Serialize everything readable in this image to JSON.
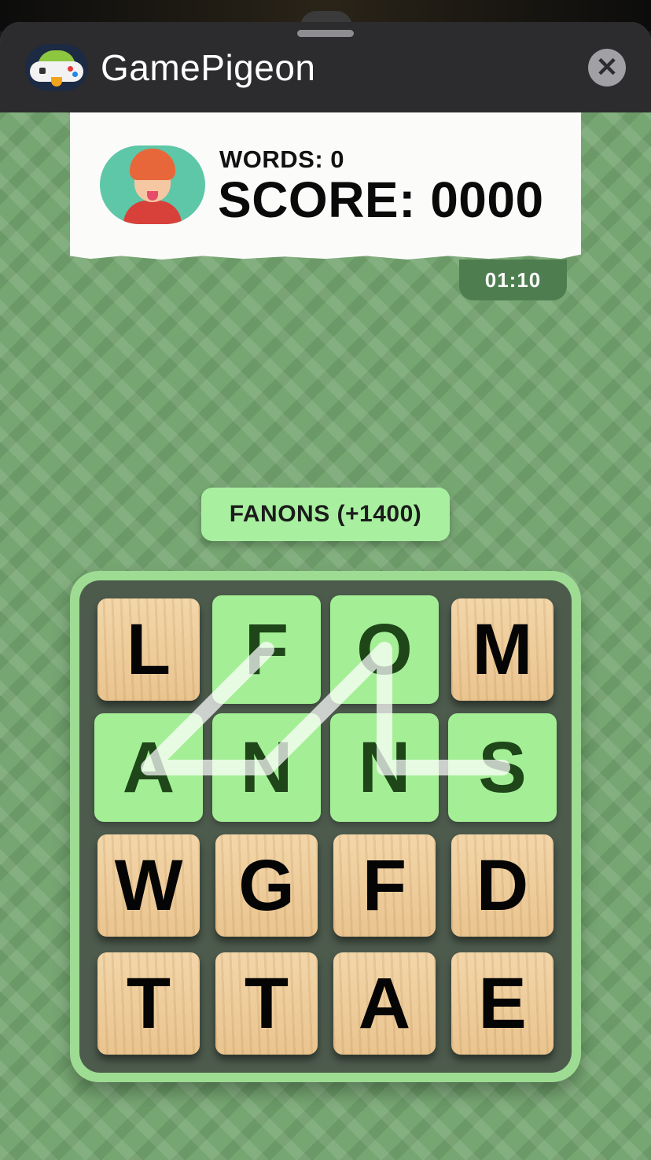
{
  "app": {
    "title": "GamePigeon",
    "close_glyph": "✕",
    "icon": "gamepigeon-bird-icon"
  },
  "player": {
    "avatar": "player-avatar",
    "words_text": "WORDS: 0",
    "score_text": "SCORE: 0000"
  },
  "timer": {
    "value": "01:10"
  },
  "current_word": {
    "text": "FANONS (+1400)"
  },
  "board": {
    "rows": [
      [
        "L",
        "F",
        "O",
        "M"
      ],
      [
        "A",
        "N",
        "N",
        "S"
      ],
      [
        "W",
        "G",
        "F",
        "D"
      ],
      [
        "T",
        "T",
        "A",
        "E"
      ]
    ],
    "selected": [
      [
        0,
        1
      ],
      [
        1,
        0
      ],
      [
        1,
        1
      ],
      [
        0,
        2
      ],
      [
        1,
        2
      ],
      [
        1,
        3
      ]
    ]
  },
  "colors": {
    "selected_tile": "#a4ef96",
    "board_border": "#9ddc92",
    "background": "#76a672"
  }
}
